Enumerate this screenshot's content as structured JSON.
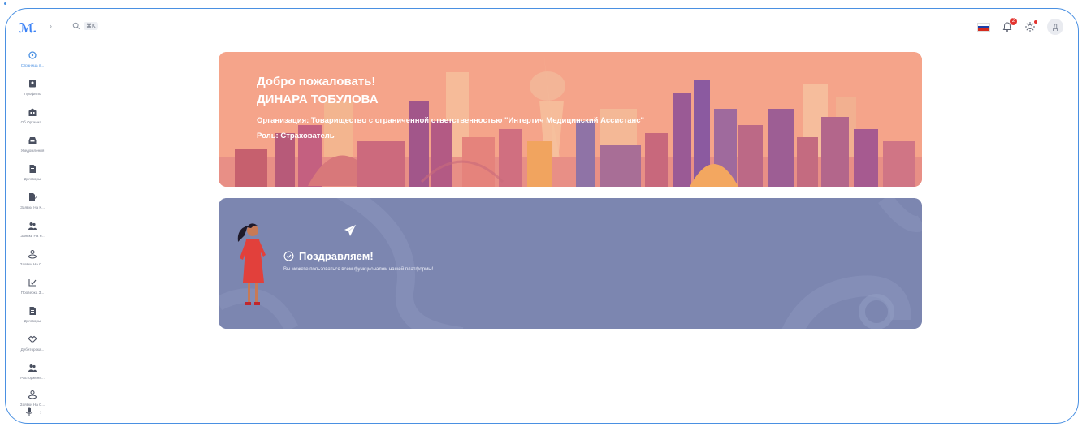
{
  "topbar": {
    "logo": "ℳ.",
    "search_shortcut": "⌘K",
    "notification_count": "2",
    "avatar_initial": "Д",
    "flag_colors": [
      "#ffffff",
      "#1c3faa",
      "#d52b1e"
    ]
  },
  "sidebar": {
    "items": [
      {
        "label": "Страница п...",
        "icon": "home-icon",
        "active": true
      },
      {
        "label": "Профиль",
        "icon": "profile-icon"
      },
      {
        "label": "Об Организ...",
        "icon": "building-icon"
      },
      {
        "label": "Уведомления",
        "icon": "inbox-icon"
      },
      {
        "label": "Договоры",
        "icon": "document-icon"
      },
      {
        "label": "Заявки На К...",
        "icon": "edit-document-icon"
      },
      {
        "label": "Заявки На Р...",
        "icon": "users-icon"
      },
      {
        "label": "Заявки На С...",
        "icon": "user-location-icon"
      },
      {
        "label": "Проверка З...",
        "icon": "check-list-icon"
      },
      {
        "label": "Договоры",
        "icon": "document-icon"
      },
      {
        "label": "Дебиторска...",
        "icon": "handshake-icon"
      },
      {
        "label": "Расторжени...",
        "icon": "users-icon"
      },
      {
        "label": "Заявки На С...",
        "icon": "user-location-icon"
      }
    ],
    "last_item_icon": "microphone-icon"
  },
  "welcome": {
    "greeting": "Добро пожаловать!",
    "name": "ДИНАРА ТОБУЛОВА",
    "organization": "Организация: Товарищество с ограниченной ответственностью \"Интертич Медицинский Ассистанс\"",
    "role": "Роль: Страхователь"
  },
  "congrats": {
    "title": "Поздравляем!",
    "subtitle": "Вы можете пользоваться всем функционалом нашей платформы!"
  },
  "colors": {
    "accent": "#4a90e2",
    "welcome_bg": "#f5a48a",
    "congrats_bg": "#7c86b0"
  }
}
